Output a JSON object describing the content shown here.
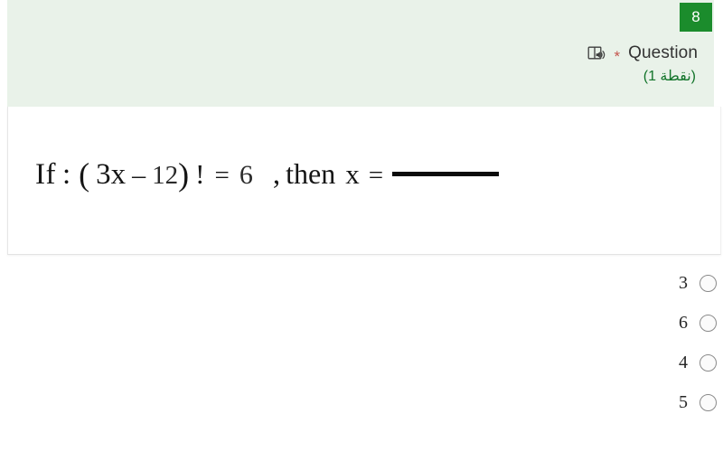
{
  "header": {
    "points_badge": "8",
    "reader_icon": "immersive-reader-icon",
    "required_marker": "*",
    "question_label": "Question",
    "points_text": "(نقطة 1)",
    "band_color": "#e9f2e9",
    "badge_color": "#1b8c2c",
    "points_text_color": "#12742a",
    "required_marker_color": "#c4554d"
  },
  "question": {
    "math": {
      "if": "If",
      "colon": ":",
      "paren_open": "(",
      "term": "3x",
      "minus": "–",
      "number": "12",
      "paren_close": ")",
      "factorial": "!",
      "equals_1": "=",
      "result": "6",
      "comma": ",",
      "then": "then",
      "variable": "x",
      "equals_2": "=",
      "blank": ""
    },
    "plain_text": "If : ( 3x – 12) ! = 6 , then x = ______"
  },
  "options": [
    {
      "label": "3",
      "selected": false
    },
    {
      "label": "6",
      "selected": false
    },
    {
      "label": "4",
      "selected": false
    },
    {
      "label": "5",
      "selected": false
    }
  ]
}
